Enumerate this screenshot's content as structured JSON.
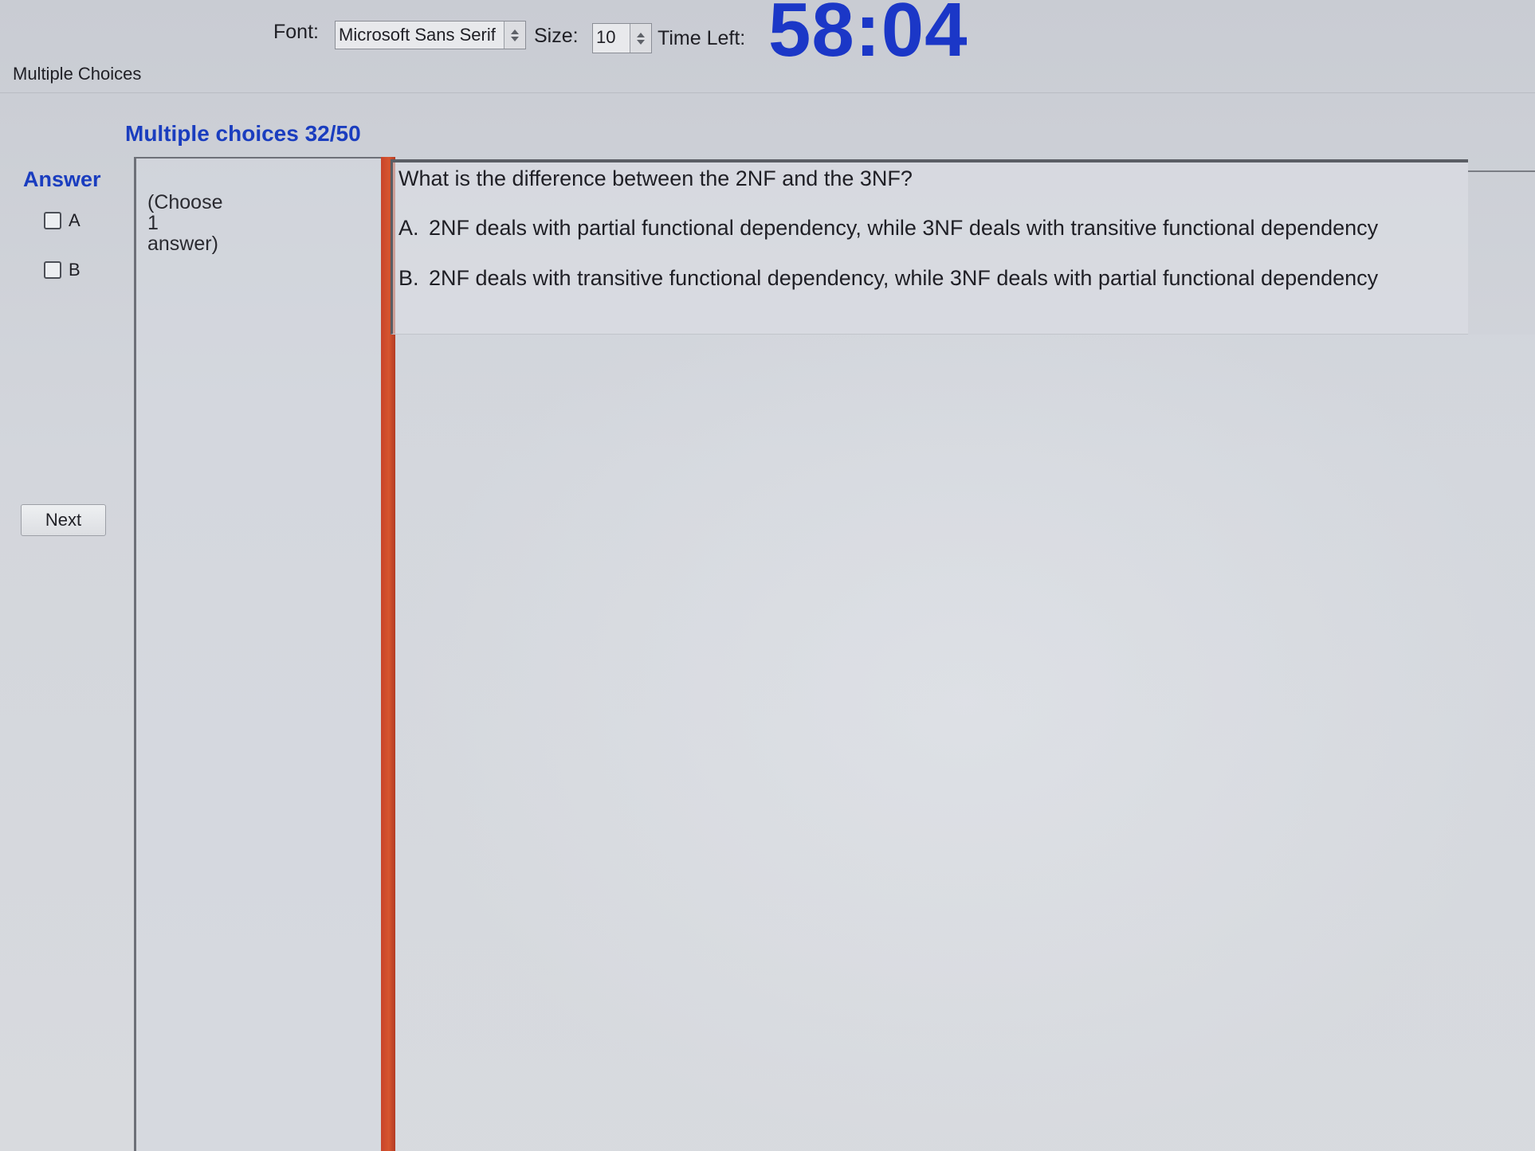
{
  "toolbar": {
    "font_label": "Font:",
    "font_value": "Microsoft Sans Serif",
    "size_label": "Size:",
    "size_value": "10",
    "time_left_label": "Time Left:",
    "timer": "58:04"
  },
  "tab": {
    "label": "Multiple Choices"
  },
  "section": {
    "title": "Multiple choices 32/50"
  },
  "answer_panel": {
    "heading": "Answer",
    "options": [
      {
        "letter": "A",
        "checked": false
      },
      {
        "letter": "B",
        "checked": false
      }
    ],
    "next_label": "Next"
  },
  "instruction": {
    "line1": "(Choose",
    "line2": "1",
    "line3": "answer)"
  },
  "question": {
    "text": "What is the difference between the 2NF and the 3NF?",
    "choices": [
      {
        "letter": "A.",
        "text": "2NF deals with partial functional dependency, while 3NF deals with transitive functional dependency"
      },
      {
        "letter": "B.",
        "text": "2NF deals with transitive functional dependency, while 3NF deals with partial functional dependency"
      }
    ]
  },
  "colors": {
    "timer": "#1b37c7",
    "heading_blue": "#1a3dbf",
    "divider_red": "#d6552f"
  }
}
